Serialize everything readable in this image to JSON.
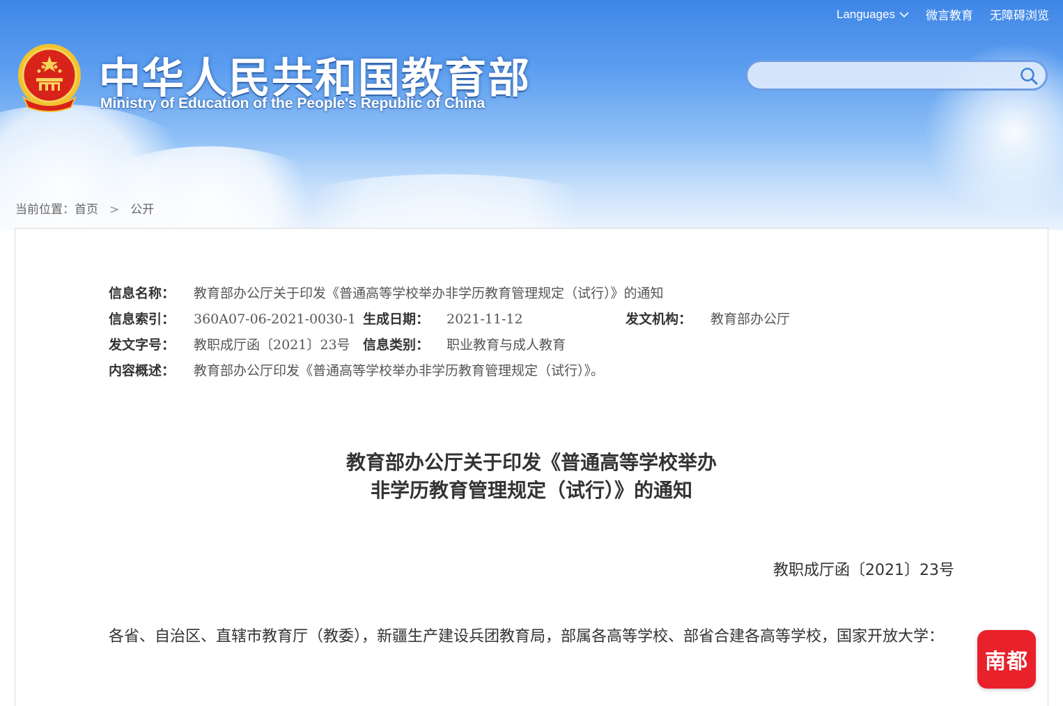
{
  "header": {
    "site_title": "中华人民共和国教育部",
    "site_subtitle": "Ministry of Education of the People's Republic of China",
    "emblem_icon": "national-emblem-icon",
    "nav": {
      "languages_label": "Languages",
      "weiyan_label": "微言教育",
      "accessibility_label": "无障碍浏览"
    },
    "search": {
      "placeholder": "",
      "icon": "search-icon"
    }
  },
  "breadcrumb": {
    "prefix": "当前位置：",
    "home": "首页",
    "separator": ">",
    "current": "公开"
  },
  "meta": {
    "info_name_label": "信息名称：",
    "info_name_value": "教育部办公厅关于印发《普通高等学校举办非学历教育管理规定（试行）》的通知",
    "index_label": "信息索引：",
    "index_value": "360A07-06-2021-0030-1",
    "date_label": "生成日期：",
    "date_value": "2021-11-12",
    "issuer_label": "发文机构：",
    "issuer_value": "教育部办公厅",
    "doc_no_label": "发文字号：",
    "doc_no_value": "教职成厅函〔2021〕23号",
    "category_label": "信息类别：",
    "category_value": "职业教育与成人教育",
    "summary_label": "内容概述：",
    "summary_value": "教育部办公厅印发《普通高等学校举办非学历教育管理规定（试行）》。"
  },
  "document": {
    "title_line1": "教育部办公厅关于印发《普通高等学校举办",
    "title_line2": "非学历教育管理规定（试行）》的通知",
    "doc_number": "教职成厅函〔2021〕23号",
    "recipients": "各省、自治区、直辖市教育厅（教委），新疆生产建设兵团教育局，部属各高等学校、部省合建各高等学校，国家开放大学："
  },
  "badge": {
    "label": "南都"
  },
  "colors": {
    "banner_blue": "#3f86e6",
    "badge_red": "#e8212b",
    "text_dark": "#333333"
  }
}
